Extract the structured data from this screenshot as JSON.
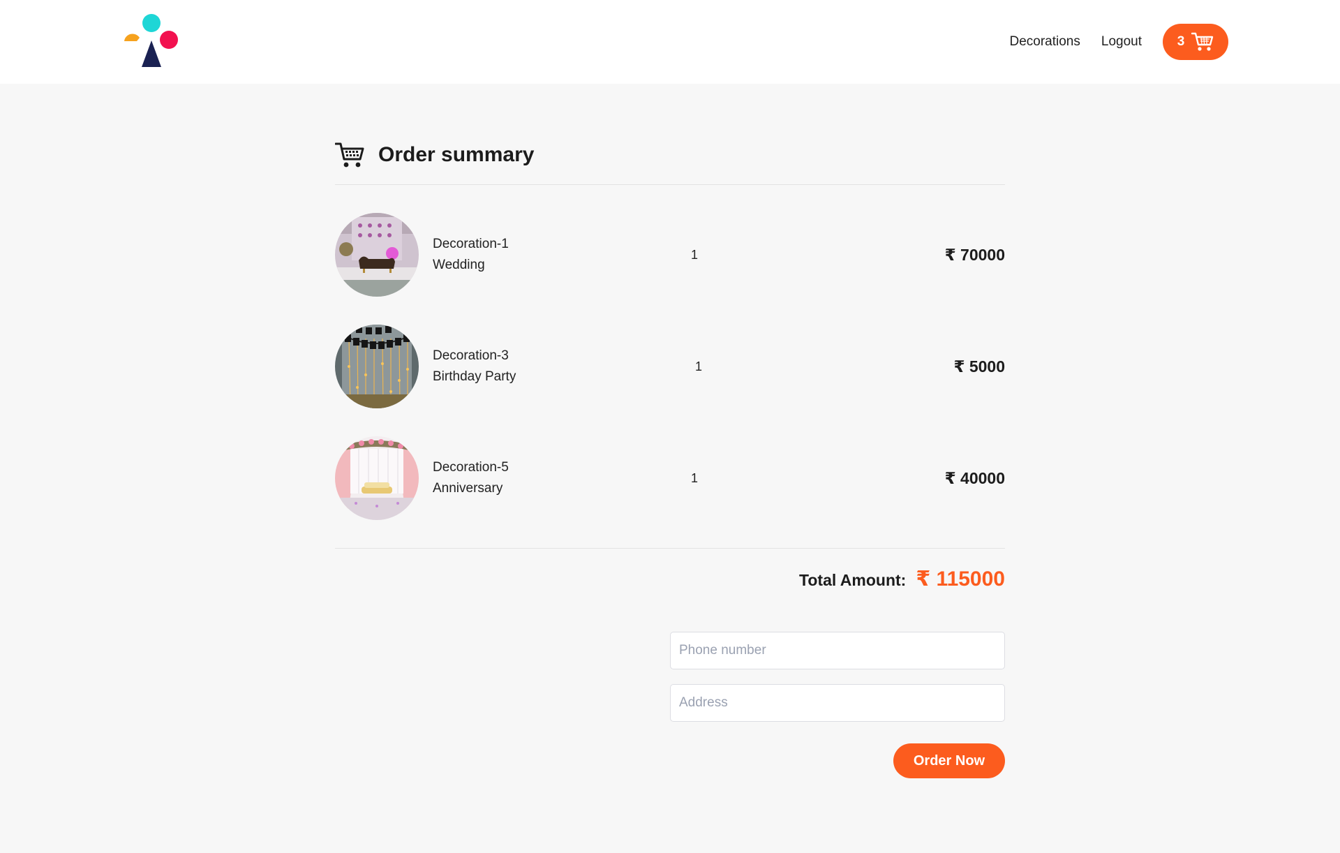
{
  "nav": {
    "links": [
      "Decorations",
      "Logout"
    ],
    "cart_count": "3"
  },
  "summary": {
    "title": "Order summary",
    "currency": "₹",
    "items": [
      {
        "name": "Decoration-1",
        "category": "Wedding",
        "qty": "1",
        "price": "₹ 70000"
      },
      {
        "name": "Decoration-3",
        "category": "Birthday Party",
        "qty": "1",
        "price": "₹ 5000"
      },
      {
        "name": "Decoration-5",
        "category": "Anniversary",
        "qty": "1",
        "price": "₹ 40000"
      }
    ],
    "total_label": "Total Amount:",
    "total_value": "₹ 115000"
  },
  "form": {
    "phone_placeholder": "Phone number",
    "address_placeholder": "Address",
    "order_button": "Order Now"
  },
  "colors": {
    "accent": "#fc5c1e",
    "background": "#f7f7f7",
    "logo_cyan": "#1ed6d6",
    "logo_pink": "#f2114f",
    "logo_orange": "#f6a21e",
    "logo_navy": "#1a2152"
  }
}
